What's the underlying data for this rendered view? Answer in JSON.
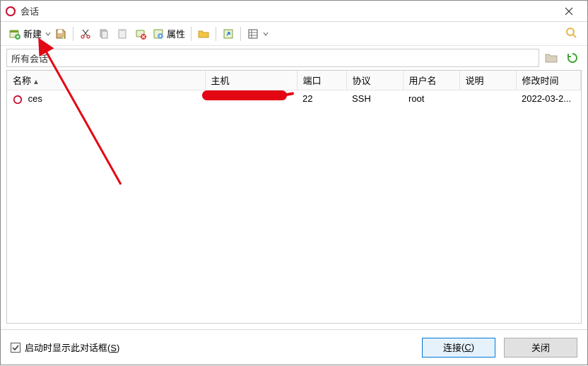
{
  "title": "会话",
  "toolbar": {
    "new_label": "新建",
    "properties_label": "属性"
  },
  "pathbar": {
    "text": "所有会话"
  },
  "columns": {
    "name": "名称",
    "host": "主机",
    "port": "端口",
    "protocol": "协议",
    "user": "用户名",
    "desc": "说明",
    "modified": "修改时间"
  },
  "rows": [
    {
      "name": "ces",
      "host": "",
      "port": "22",
      "protocol": "SSH",
      "user": "root",
      "desc": "",
      "modified": "2022-03-2..."
    }
  ],
  "footer": {
    "checkbox_label": "启动时显示此对话框",
    "checkbox_key": "S",
    "connect_label": "连接",
    "connect_key": "C",
    "close_label": "关闭"
  }
}
